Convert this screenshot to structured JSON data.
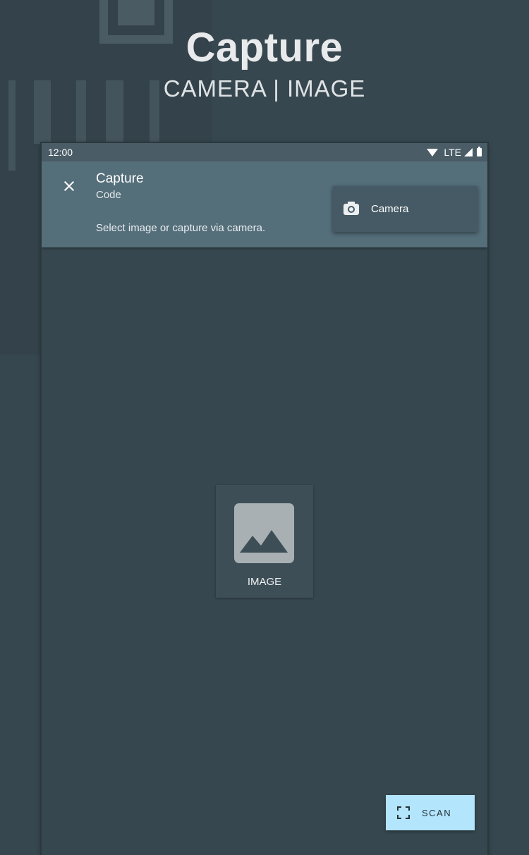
{
  "promo": {
    "title": "Capture",
    "subtitle": "CAMERA | IMAGE"
  },
  "status_bar": {
    "time": "12:00",
    "network": "LTE",
    "icons": [
      "wifi-icon",
      "signal-icon",
      "battery-icon"
    ]
  },
  "app_bar": {
    "title": "Capture",
    "subtitle": "Code",
    "hint": "Select image or capture via camera.",
    "close_icon": "close-icon"
  },
  "menu": {
    "items": [
      {
        "icon": "camera-icon",
        "label": "Camera"
      }
    ]
  },
  "main": {
    "image_tile": {
      "icon": "image-icon",
      "label": "IMAGE"
    }
  },
  "scan_button": {
    "icon": "scan-frame-icon",
    "label": "SCAN"
  },
  "colors": {
    "background": "#37474f",
    "app_bar": "#546e7a",
    "status_bar": "#4a5c66",
    "menu": "#455a64",
    "scan_button": "#b3e5fc"
  }
}
